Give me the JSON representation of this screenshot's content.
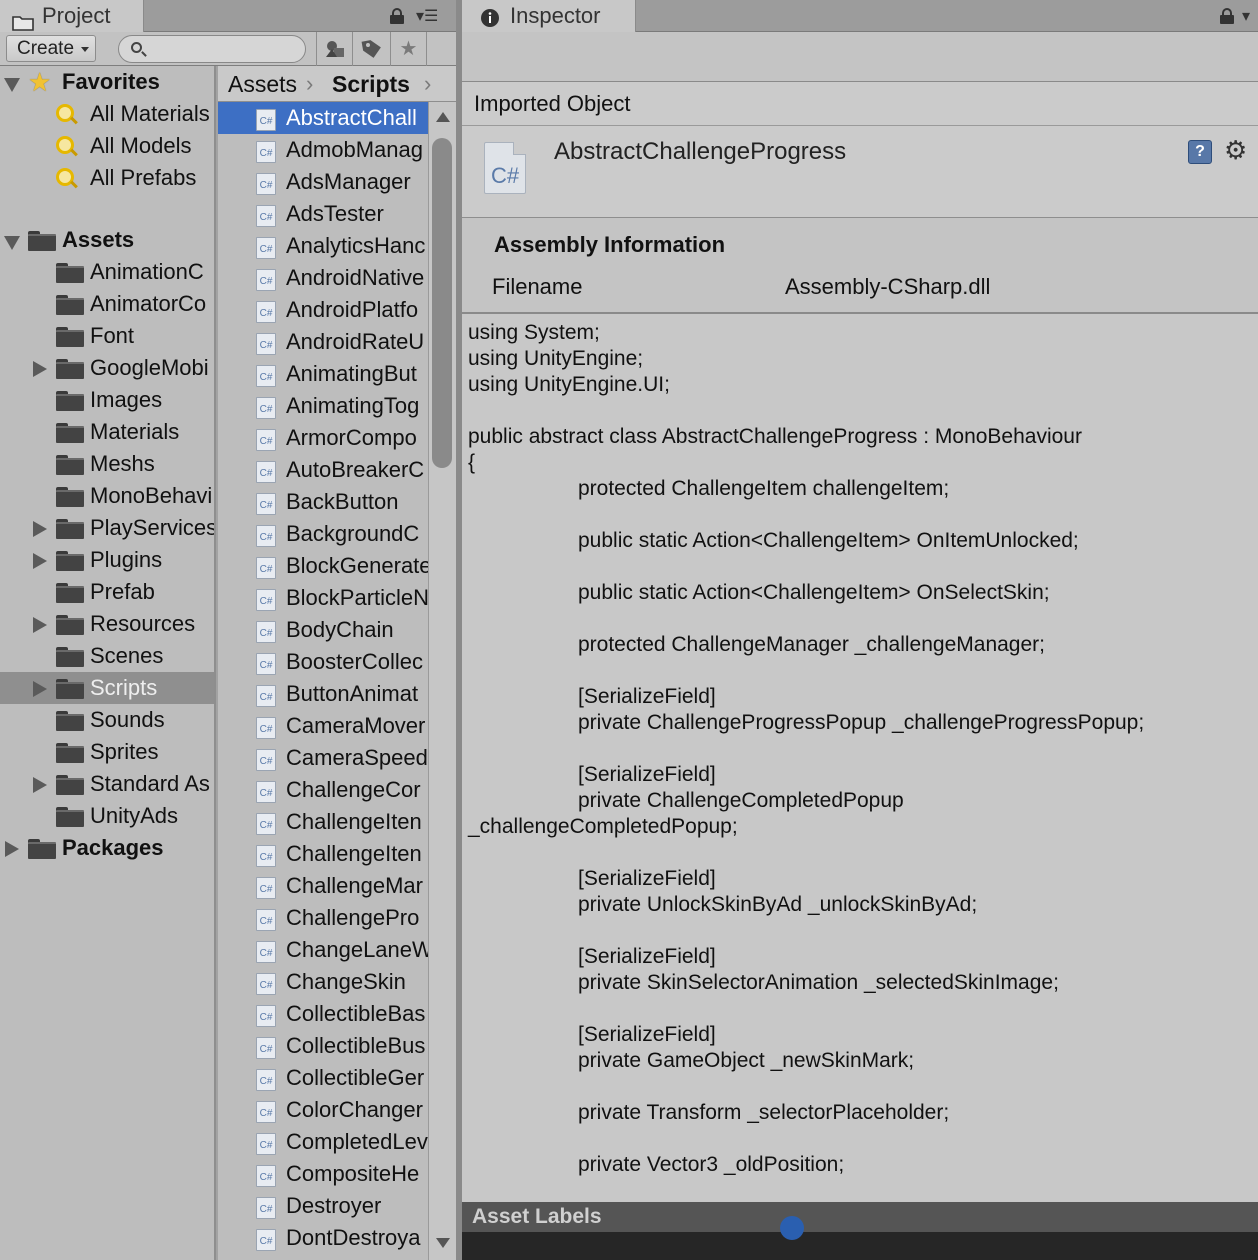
{
  "project_panel": {
    "tab_label": "Project",
    "toolbar": {
      "create_label": "Create"
    },
    "search": {
      "placeholder": ""
    },
    "favorites": {
      "label": "Favorites",
      "items": [
        "All Materials",
        "All Models",
        "All Prefabs"
      ]
    },
    "assets": {
      "label": "Assets",
      "folders": [
        {
          "label": "AnimationC",
          "expandable": false
        },
        {
          "label": "AnimatorCo",
          "expandable": false
        },
        {
          "label": "Font",
          "expandable": false
        },
        {
          "label": "GoogleMobi",
          "expandable": true
        },
        {
          "label": "Images",
          "expandable": false
        },
        {
          "label": "Materials",
          "expandable": false
        },
        {
          "label": "Meshs",
          "expandable": false
        },
        {
          "label": "MonoBehavi",
          "expandable": false
        },
        {
          "label": "PlayServices",
          "expandable": true
        },
        {
          "label": "Plugins",
          "expandable": true
        },
        {
          "label": "Prefab",
          "expandable": false
        },
        {
          "label": "Resources",
          "expandable": true
        },
        {
          "label": "Scenes",
          "expandable": false
        },
        {
          "label": "Scripts",
          "expandable": true,
          "selected": true
        },
        {
          "label": "Sounds",
          "expandable": false
        },
        {
          "label": "Sprites",
          "expandable": false
        },
        {
          "label": "Standard As",
          "expandable": true
        },
        {
          "label": "UnityAds",
          "expandable": false
        }
      ]
    },
    "packages": {
      "label": "Packages"
    },
    "breadcrumb": {
      "root": "Assets",
      "current": "Scripts"
    },
    "file_icon_text": "C#",
    "files": [
      "AbstractChall",
      "AdmobManag",
      "AdsManager",
      "AdsTester",
      "AnalyticsHanc",
      "AndroidNative",
      "AndroidPlatfo",
      "AndroidRateU",
      "AnimatingBut",
      "AnimatingTog",
      "ArmorCompo",
      "AutoBreakerC",
      "BackButton",
      "BackgroundC",
      "BlockGenerate",
      "BlockParticleN",
      "BodyChain",
      "BoosterCollec",
      "ButtonAnimat",
      "CameraMover",
      "CameraSpeed",
      "ChallengeCor",
      "ChallengeIten",
      "ChallengeIten",
      "ChallengeMar",
      "ChallengePro",
      "ChangeLaneW",
      "ChangeSkin",
      "CollectibleBas",
      "CollectibleBus",
      "CollectibleGer",
      "ColorChanger",
      "CompletedLev",
      "CompositeHe",
      "Destroyer",
      "DontDestroya"
    ]
  },
  "inspector": {
    "tab_label": "Inspector",
    "imported_object_label": "Imported Object",
    "object_icon_text": "C#",
    "object_name": "AbstractChallengeProgress",
    "help_icon_text": "?",
    "assembly": {
      "title": "Assembly Information",
      "filename_label": "Filename",
      "filename_value": "Assembly-CSharp.dll"
    },
    "code_lines": [
      {
        "text": "using System;",
        "indent": false
      },
      {
        "text": "using UnityEngine;",
        "indent": false
      },
      {
        "text": "using UnityEngine.UI;",
        "indent": false
      },
      {
        "text": "",
        "indent": false
      },
      {
        "text": "public abstract class AbstractChallengeProgress : MonoBehaviour",
        "indent": false
      },
      {
        "text": "{",
        "indent": false
      },
      {
        "text": "protected ChallengeItem challengeItem;",
        "indent": true
      },
      {
        "text": "",
        "indent": false
      },
      {
        "text": "public static Action<ChallengeItem> OnItemUnlocked;",
        "indent": true
      },
      {
        "text": "",
        "indent": false
      },
      {
        "text": "public static Action<ChallengeItem> OnSelectSkin;",
        "indent": true
      },
      {
        "text": "",
        "indent": false
      },
      {
        "text": "protected ChallengeManager _challengeManager;",
        "indent": true
      },
      {
        "text": "",
        "indent": false
      },
      {
        "text": "[SerializeField]",
        "indent": true
      },
      {
        "text": "private ChallengeProgressPopup _challengeProgressPopup;",
        "indent": true
      },
      {
        "text": "",
        "indent": false
      },
      {
        "text": "[SerializeField]",
        "indent": true
      },
      {
        "text": "private ChallengeCompletedPopup",
        "indent": true
      },
      {
        "text": "_challengeCompletedPopup;",
        "indent": false
      },
      {
        "text": "",
        "indent": false
      },
      {
        "text": "[SerializeField]",
        "indent": true
      },
      {
        "text": "private UnlockSkinByAd _unlockSkinByAd;",
        "indent": true
      },
      {
        "text": "",
        "indent": false
      },
      {
        "text": "[SerializeField]",
        "indent": true
      },
      {
        "text": "private SkinSelectorAnimation _selectedSkinImage;",
        "indent": true
      },
      {
        "text": "",
        "indent": false
      },
      {
        "text": "[SerializeField]",
        "indent": true
      },
      {
        "text": "private GameObject _newSkinMark;",
        "indent": true
      },
      {
        "text": "",
        "indent": false
      },
      {
        "text": "private Transform _selectorPlaceholder;",
        "indent": true
      },
      {
        "text": "",
        "indent": false
      },
      {
        "text": "private Vector3 _oldPosition;",
        "indent": true
      }
    ],
    "asset_labels_label": "Asset Labels"
  },
  "icons": [
    "folder-icon",
    "lock-icon",
    "menu-icon",
    "search-icon",
    "filter-by-type-icon",
    "filter-by-label-icon",
    "favorites-star-icon",
    "help-icon",
    "gear-icon",
    "info-icon",
    "csharp-file-icon"
  ],
  "colors": {
    "selection": "#3d6fc4",
    "panel_bg": "#bdbdbd",
    "asset_labels_bg": "#555555"
  }
}
